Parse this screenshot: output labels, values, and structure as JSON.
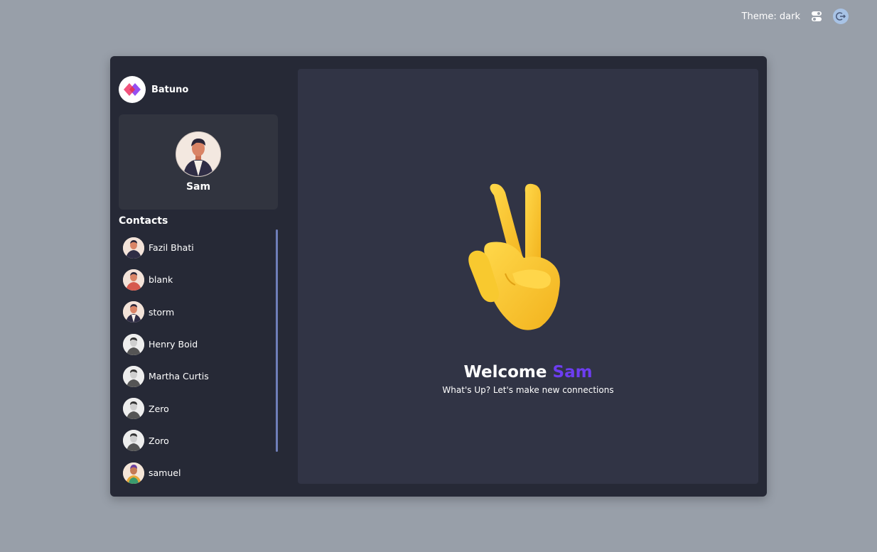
{
  "header": {
    "theme_label": "Theme: dark",
    "toggle_icon": "theme-toggle-icon",
    "logout_icon": "logout-icon"
  },
  "brand": {
    "name": "Batuno",
    "logo_icon": "batuno-logo"
  },
  "profile": {
    "name": "Sam"
  },
  "contacts": {
    "title": "Contacts",
    "items": [
      {
        "name": "Fazil Bhati"
      },
      {
        "name": "blank"
      },
      {
        "name": "storm"
      },
      {
        "name": "Henry Boid"
      },
      {
        "name": "Martha Curtis"
      },
      {
        "name": "Zero"
      },
      {
        "name": "Zoro"
      },
      {
        "name": "samuel"
      }
    ]
  },
  "main": {
    "welcome_prefix": "Welcome",
    "welcome_name": "Sam",
    "subtitle": "What's Up? Let's make new connections"
  },
  "colors": {
    "page_bg": "#989fa9",
    "app_bg": "#262936",
    "main_bg": "#313445",
    "accent": "#6d3df0"
  }
}
